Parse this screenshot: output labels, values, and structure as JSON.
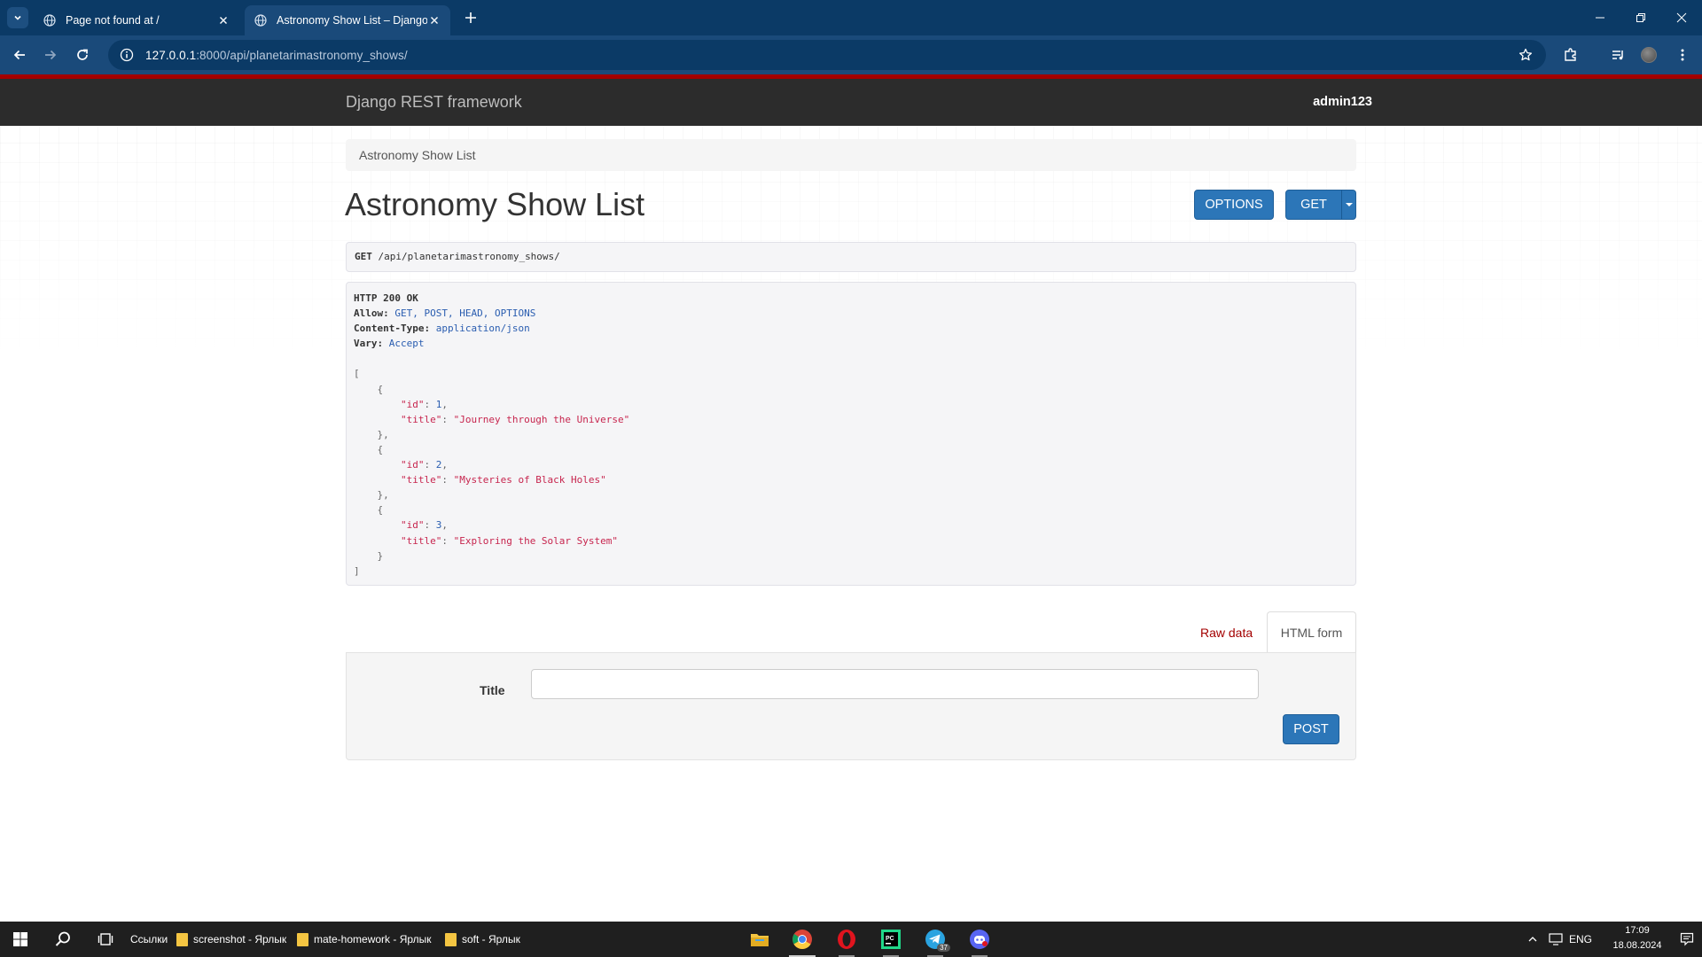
{
  "browser": {
    "tabs": [
      {
        "title": "Page not found at /",
        "active": false
      },
      {
        "title": "Astronomy Show List – Django",
        "active": true
      }
    ],
    "url_host": "127.0.0.1",
    "url_rest": ":8000/api/planetarimastronomy_shows/"
  },
  "drf": {
    "brand": "Django REST framework",
    "user": "admin123",
    "breadcrumb": "Astronomy Show List",
    "title": "Astronomy Show List",
    "options_label": "OPTIONS",
    "get_label": "GET",
    "request_method": "GET",
    "request_path": "/api/planetarimastronomy_shows/",
    "response": {
      "status": "HTTP 200 OK",
      "headers": [
        {
          "name": "Allow",
          "value": "GET, POST, HEAD, OPTIONS"
        },
        {
          "name": "Content-Type",
          "value": "application/json"
        },
        {
          "name": "Vary",
          "value": "Accept"
        }
      ],
      "items": [
        {
          "id": 1,
          "title": "Journey through the Universe"
        },
        {
          "id": 2,
          "title": "Mysteries of Black Holes"
        },
        {
          "id": 3,
          "title": "Exploring the Solar System"
        }
      ]
    },
    "tabs": {
      "raw": "Raw data",
      "html": "HTML form"
    },
    "form": {
      "label": "Title",
      "value": "",
      "submit": "POST"
    }
  },
  "taskbar": {
    "links_label": "Ссылки",
    "shortcuts": [
      "screenshot - Ярлык",
      "mate-homework - Ярлык",
      "soft - Ярлык"
    ],
    "lang": "ENG",
    "time": "17:09",
    "date": "18.08.2024",
    "telegram_badge": "37"
  },
  "colors": {
    "accent": "#2c76b8",
    "drf_red": "#a30000",
    "browser_frame": "#0b3a66"
  }
}
